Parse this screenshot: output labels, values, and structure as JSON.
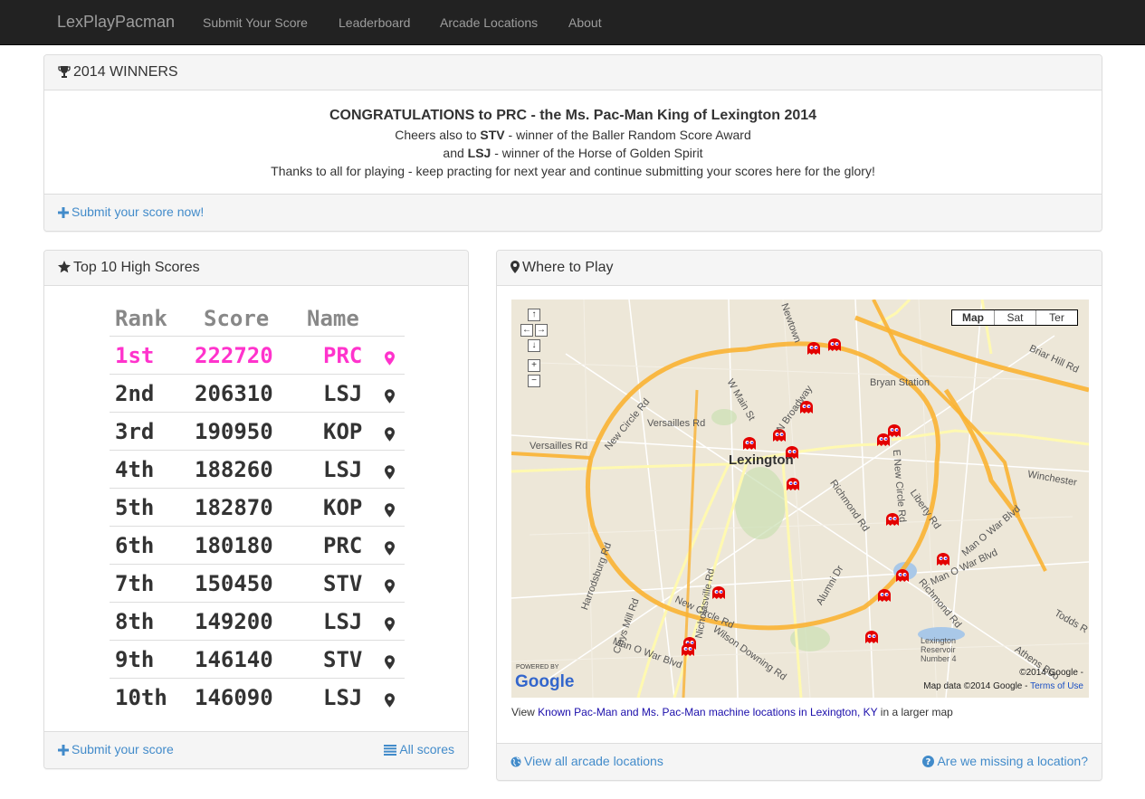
{
  "nav": {
    "brand": "LexPlayPacman",
    "items": [
      "Submit Your Score",
      "Leaderboard",
      "Arcade Locations",
      "About"
    ]
  },
  "winners": {
    "title": "2014 WINNERS",
    "headline": "CONGRATULATIONS to PRC - the Ms. Pac-Man King of Lexington 2014",
    "line2_prefix": "Cheers also to ",
    "line2_name": "STV",
    "line2_suffix": " - winner of the Baller Random Score Award",
    "line3_prefix": "and ",
    "line3_name": "LSJ",
    "line3_suffix": " - winner of the Horse of Golden Spirit",
    "line4": "Thanks to all for playing - keep practing for next year and continue submitting your scores here for the glory!",
    "footer_link": "Submit your score now!"
  },
  "scores": {
    "title": "Top 10 High Scores",
    "columns": [
      "Rank",
      "Score",
      "Name"
    ],
    "rows": [
      {
        "rank": "1st",
        "score": "222720",
        "name": "PRC"
      },
      {
        "rank": "2nd",
        "score": "206310",
        "name": "LSJ"
      },
      {
        "rank": "3rd",
        "score": "190950",
        "name": "KOP"
      },
      {
        "rank": "4th",
        "score": "188260",
        "name": "LSJ"
      },
      {
        "rank": "5th",
        "score": "182870",
        "name": "KOP"
      },
      {
        "rank": "6th",
        "score": "180180",
        "name": "PRC"
      },
      {
        "rank": "7th",
        "score": "150450",
        "name": "STV"
      },
      {
        "rank": "8th",
        "score": "149200",
        "name": "LSJ"
      },
      {
        "rank": "9th",
        "score": "146140",
        "name": "STV"
      },
      {
        "rank": "10th",
        "score": "146090",
        "name": "LSJ"
      }
    ],
    "footer_submit": "Submit your score",
    "footer_all": "All scores",
    "highlight_color": "#ff33cc"
  },
  "where": {
    "title": "Where to Play",
    "map_types": [
      "Map",
      "Sat",
      "Ter"
    ],
    "map_city": "Lexington",
    "map_labels": [
      "New Circle Rd",
      "New Circle Rd",
      "Versailles Rd",
      "Versailles Rd",
      "W Main St",
      "N Broadway",
      "Richmond Rd",
      "Winchester",
      "Liberty Rd",
      "E New Circle Rd",
      "Man O War Blvd",
      "Man O War Blvd",
      "Nicholasville Rd",
      "Harrodsburg Rd",
      "Alumni Dr",
      "Clays Mill Rd",
      "Wilson Downing Rd",
      "Todds R",
      "Briar Hill Rd",
      "Bryan Station",
      "Newtown",
      "Lexington Reservoir Number 4",
      "Athens Boo",
      "Richmond Rd",
      "Man O War Blvd"
    ],
    "map_copyright": "©2014 Google -",
    "map_data": "Map data ©2014 Google -",
    "map_terms": "Terms of Use",
    "powered_by": "POWERED BY",
    "google": "Google",
    "caption_prefix": "View ",
    "caption_link": "Known Pac-Man and Ms. Pac-Man machine locations in Lexington, KY",
    "caption_suffix": " in a larger map",
    "footer_left": "View all arcade locations",
    "footer_right": "Are we missing a location?"
  },
  "colors": {
    "navbar": "#222222",
    "link": "#428bca",
    "ghost": "#e30000",
    "road": "#f9b233"
  }
}
